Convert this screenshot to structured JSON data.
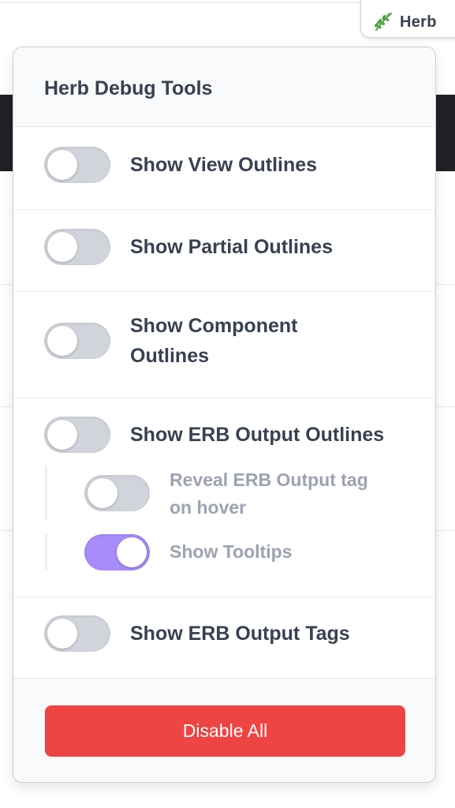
{
  "badge": {
    "label": "Herb",
    "icon": "herb-leaf-icon",
    "icon_color": "#3a8a3a"
  },
  "panel": {
    "title": "Herb Debug Tools",
    "options": [
      {
        "label": "Show View Outlines",
        "enabled": false
      },
      {
        "label": "Show Partial Outlines",
        "enabled": false
      },
      {
        "label_line1": "Show Component",
        "label_line2": "Outlines",
        "enabled": false
      },
      {
        "label": "Show ERB Output Outlines",
        "enabled": false,
        "sub_options": [
          {
            "label_line1": "Reveal ERB Output tag",
            "label_line2": "on hover",
            "enabled": false
          },
          {
            "label": "Show Tooltips",
            "enabled": true
          }
        ]
      },
      {
        "label": "Show ERB Output Tags",
        "enabled": false
      }
    ],
    "disable_all_label": "Disable All"
  },
  "colors": {
    "accent_toggle_on": "#a78bfa",
    "toggle_off": "#d1d5db",
    "danger_button": "#ef4444",
    "text_primary": "#374151",
    "text_muted": "#9ca3af"
  }
}
